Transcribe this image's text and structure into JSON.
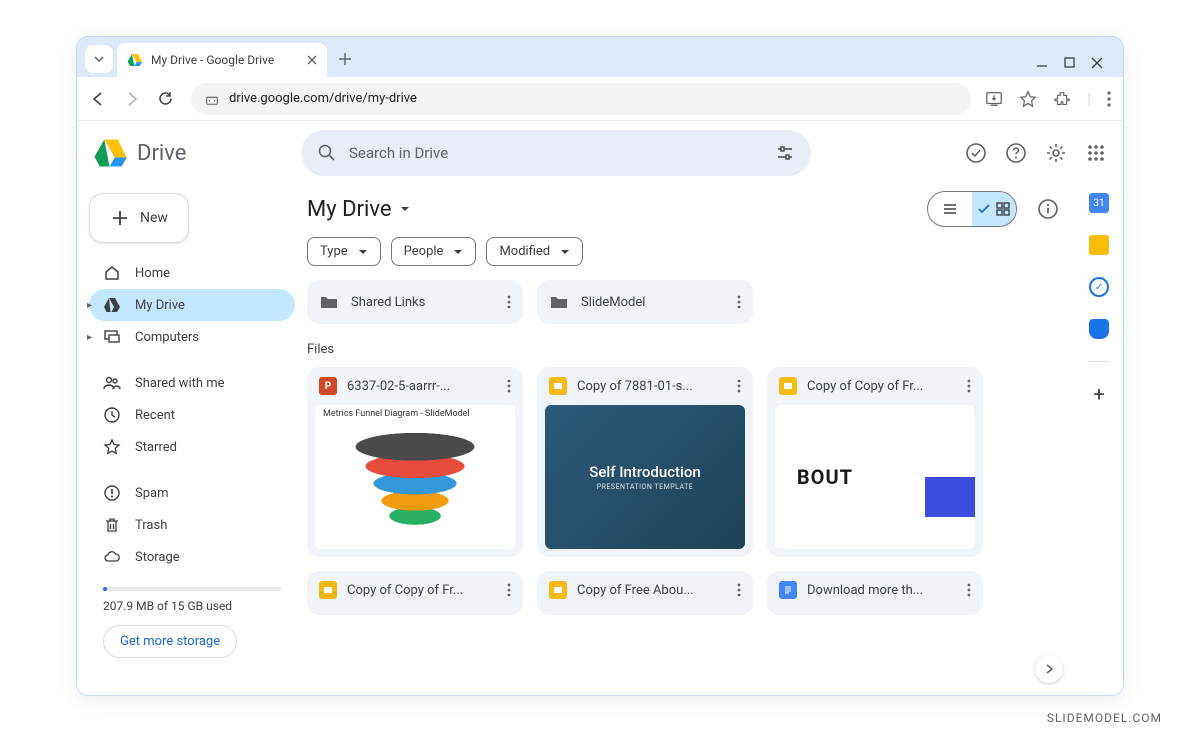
{
  "browser": {
    "tab_title": "My Drive - Google Drive",
    "url": "drive.google.com/drive/my-drive"
  },
  "app": {
    "name": "Drive",
    "search_placeholder": "Search in Drive"
  },
  "sidebar": {
    "new_label": "New",
    "items": [
      {
        "label": "Home",
        "icon": "home"
      },
      {
        "label": "My Drive",
        "icon": "mydrive",
        "active": true,
        "expandable": true
      },
      {
        "label": "Computers",
        "icon": "computers",
        "expandable": true
      },
      {
        "label": "Shared with me",
        "icon": "shared"
      },
      {
        "label": "Recent",
        "icon": "recent"
      },
      {
        "label": "Starred",
        "icon": "star"
      },
      {
        "label": "Spam",
        "icon": "spam"
      },
      {
        "label": "Trash",
        "icon": "trash"
      },
      {
        "label": "Storage",
        "icon": "cloud"
      }
    ],
    "storage_text": "207.9 MB of 15 GB used",
    "get_more": "Get more storage"
  },
  "main": {
    "breadcrumb": "My Drive",
    "filters": [
      {
        "label": "Type"
      },
      {
        "label": "People"
      },
      {
        "label": "Modified"
      }
    ],
    "folders": [
      {
        "name": "Shared Links"
      },
      {
        "name": "SlideModel"
      }
    ],
    "files_label": "Files",
    "files": [
      {
        "name": "6337-02-5-aarrr-...",
        "type": "ppt",
        "thumb": "funnel",
        "thumb_title": "Metrics Funnel Diagram - SlideModel"
      },
      {
        "name": "Copy of 7881-01-s...",
        "type": "slides",
        "thumb": "self",
        "thumb_title": "Self Introduction",
        "thumb_sub": "PRESENTATION TEMPLATE"
      },
      {
        "name": "Copy of Copy of Fr...",
        "type": "slides",
        "thumb": "about",
        "thumb_title": "BOUT"
      },
      {
        "name": "Copy of Copy of Fr...",
        "type": "slides"
      },
      {
        "name": "Copy of Free Abou...",
        "type": "slides"
      },
      {
        "name": "Download more th...",
        "type": "docs"
      }
    ]
  },
  "watermark": "SLIDEMODEL.COM"
}
